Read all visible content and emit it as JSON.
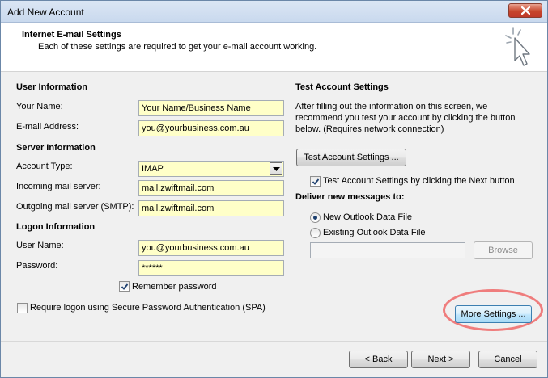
{
  "window": {
    "title": "Add New Account"
  },
  "header": {
    "title": "Internet E-mail Settings",
    "subtitle": "Each of these settings are required to get your e-mail account working."
  },
  "user_info": {
    "title": "User Information",
    "name_label": "Your Name:",
    "name_value": "Your Name/Business Name",
    "email_label": "E-mail Address:",
    "email_value": "you@yourbusiness.com.au"
  },
  "server_info": {
    "title": "Server Information",
    "account_type_label": "Account Type:",
    "account_type_value": "IMAP",
    "incoming_label": "Incoming mail server:",
    "incoming_value": "mail.zwiftmail.com",
    "outgoing_label": "Outgoing mail server (SMTP):",
    "outgoing_value": "mail.zwiftmail.com"
  },
  "logon_info": {
    "title": "Logon Information",
    "username_label": "User Name:",
    "username_value": "you@yourbusiness.com.au",
    "password_label": "Password:",
    "password_value": "******",
    "remember_label": "Remember password",
    "remember_checked": true,
    "spa_label": "Require logon using Secure Password Authentication (SPA)",
    "spa_checked": false
  },
  "test_settings": {
    "title": "Test Account Settings",
    "description": "After filling out the information on this screen, we recommend you test your account by clicking the button below. (Requires network connection)",
    "test_button": "Test Account Settings ...",
    "test_next_label": "Test Account Settings by clicking the Next button",
    "test_next_checked": true
  },
  "deliver": {
    "title": "Deliver new messages to:",
    "new_file_label": "New Outlook Data File",
    "existing_file_label": "Existing Outlook Data File",
    "selected": "new",
    "browse_button": "Browse"
  },
  "more_settings_button": "More Settings ...",
  "footer": {
    "back_button": "< Back",
    "next_button": "Next >",
    "cancel_button": "Cancel"
  },
  "colors": {
    "field_background": "#ffffc8",
    "highlight_ring": "#ef7d7d"
  }
}
